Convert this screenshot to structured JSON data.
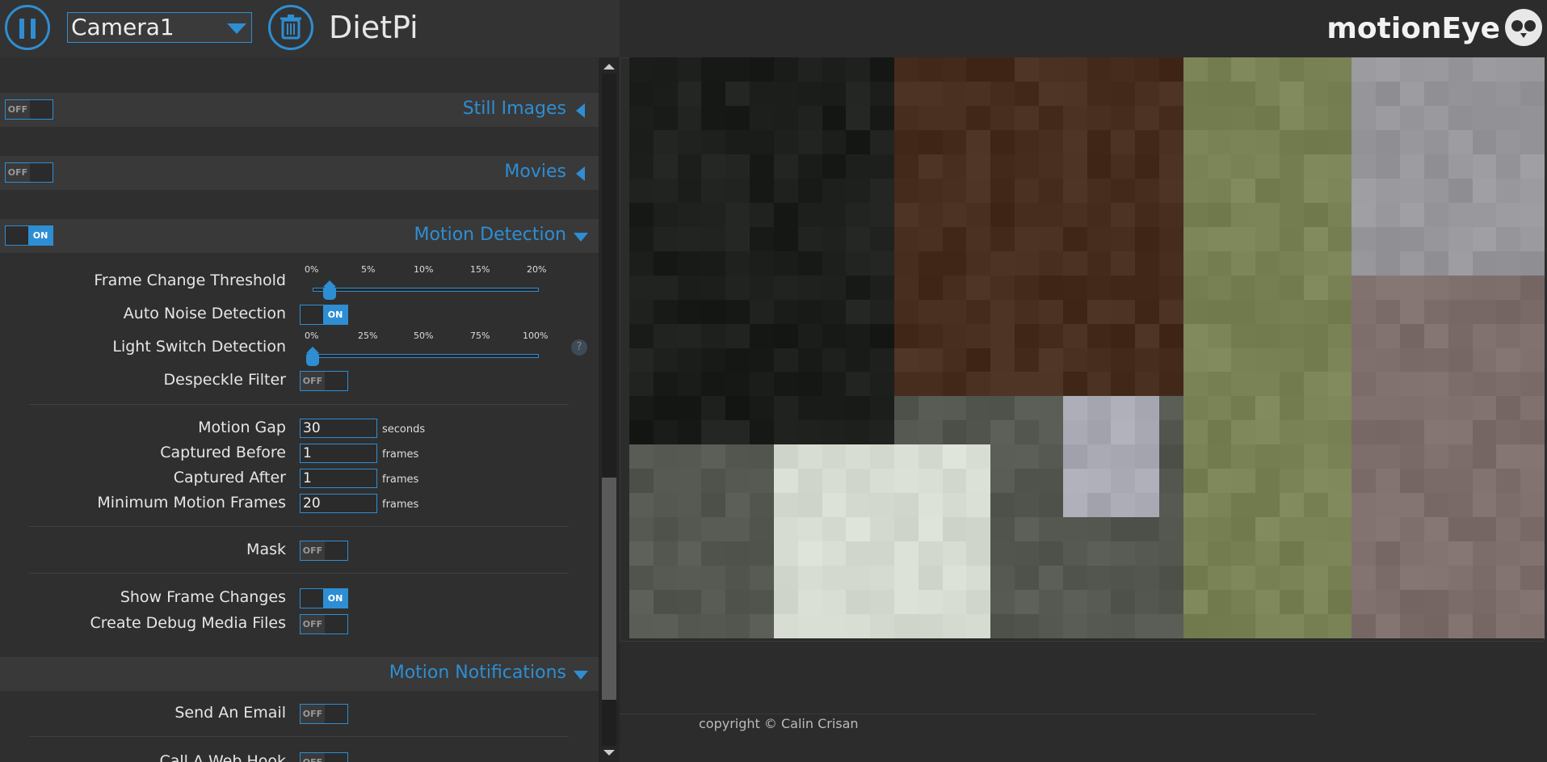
{
  "header": {
    "camera_select": "Camera1",
    "host_name": "DietPi",
    "brand": "motionEye"
  },
  "sections": {
    "still_images": {
      "title": "Still Images",
      "enabled": "OFF"
    },
    "movies": {
      "title": "Movies",
      "enabled": "OFF"
    },
    "motion_detection": {
      "title": "Motion Detection",
      "enabled": "ON"
    },
    "motion_notifications": {
      "title": "Motion Notifications"
    }
  },
  "motion": {
    "frame_change_threshold": {
      "label": "Frame Change Threshold",
      "ticks": [
        "0%",
        "5%",
        "10%",
        "15%",
        "20%"
      ],
      "value_percent": 1.5
    },
    "auto_noise_detection": {
      "label": "Auto Noise Detection",
      "state": "ON"
    },
    "light_switch_detection": {
      "label": "Light Switch Detection",
      "ticks": [
        "0%",
        "25%",
        "50%",
        "75%",
        "100%"
      ],
      "value_percent": 0,
      "help": "?"
    },
    "despeckle_filter": {
      "label": "Despeckle Filter",
      "state": "OFF"
    },
    "motion_gap": {
      "label": "Motion Gap",
      "value": "30",
      "unit": "seconds"
    },
    "captured_before": {
      "label": "Captured Before",
      "value": "1",
      "unit": "frames"
    },
    "captured_after": {
      "label": "Captured After",
      "value": "1",
      "unit": "frames"
    },
    "minimum_motion_frames": {
      "label": "Minimum Motion Frames",
      "value": "20",
      "unit": "frames"
    },
    "mask": {
      "label": "Mask",
      "state": "OFF"
    },
    "show_frame_changes": {
      "label": "Show Frame Changes",
      "state": "ON"
    },
    "create_debug_media_files": {
      "label": "Create Debug Media Files",
      "state": "OFF"
    }
  },
  "notifications": {
    "send_an_email": {
      "label": "Send An Email",
      "state": "OFF"
    },
    "call_a_web_hook": {
      "label": "Call A Web Hook",
      "state": "OFF"
    }
  },
  "footer": {
    "copyright": "copyright © Calin Crisan"
  },
  "colors": {
    "accent": "#2e8ed3",
    "panel": "#2f2f2f",
    "section_header": "#393939",
    "background": "#2c2c2c"
  },
  "icons": [
    "menu-icon",
    "trash-icon",
    "chevron-down-icon",
    "owl-logo-icon"
  ]
}
